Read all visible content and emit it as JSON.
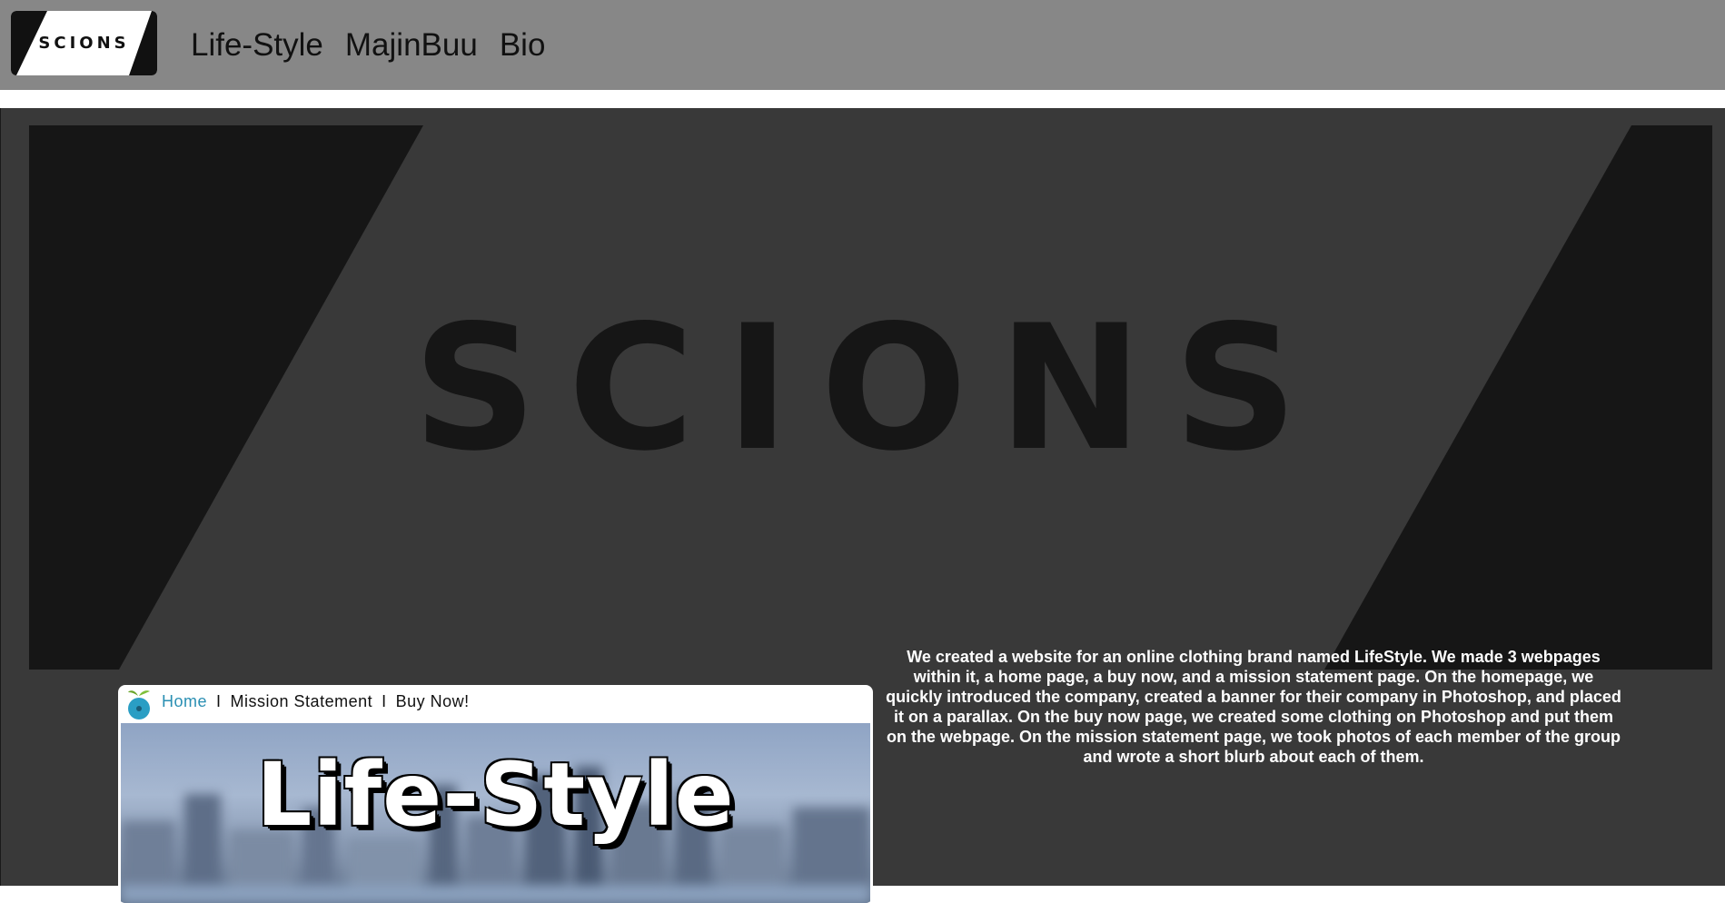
{
  "header": {
    "logo_text": "SCIONS",
    "nav": [
      "Life-Style",
      "MajinBuu",
      "Bio"
    ]
  },
  "banner": {
    "word": "SCIONS"
  },
  "project_card": {
    "nav": {
      "home": "Home",
      "separator": "I",
      "mission": "Mission Statement",
      "buy": "Buy Now!"
    },
    "hero_title": "Life-Style"
  },
  "description": "We created a website for an online clothing brand named LifeStyle. We made 3 webpages within it, a home page, a buy now, and a mission statement page. On the homepage, we quickly introduced the company, created a banner for their company in Photoshop, and placed it on a parallax. On the buy now page, we created some clothing on Photoshop and put them on the webpage. On the mission statement page, we took photos of each member of the group and wrote a short blurb about each of them.",
  "colors": {
    "topbar": "#878787",
    "main_bg": "#393939",
    "banner_shape": "#161616",
    "link_active": "#2a8fb3",
    "text_light": "#ffffff"
  }
}
